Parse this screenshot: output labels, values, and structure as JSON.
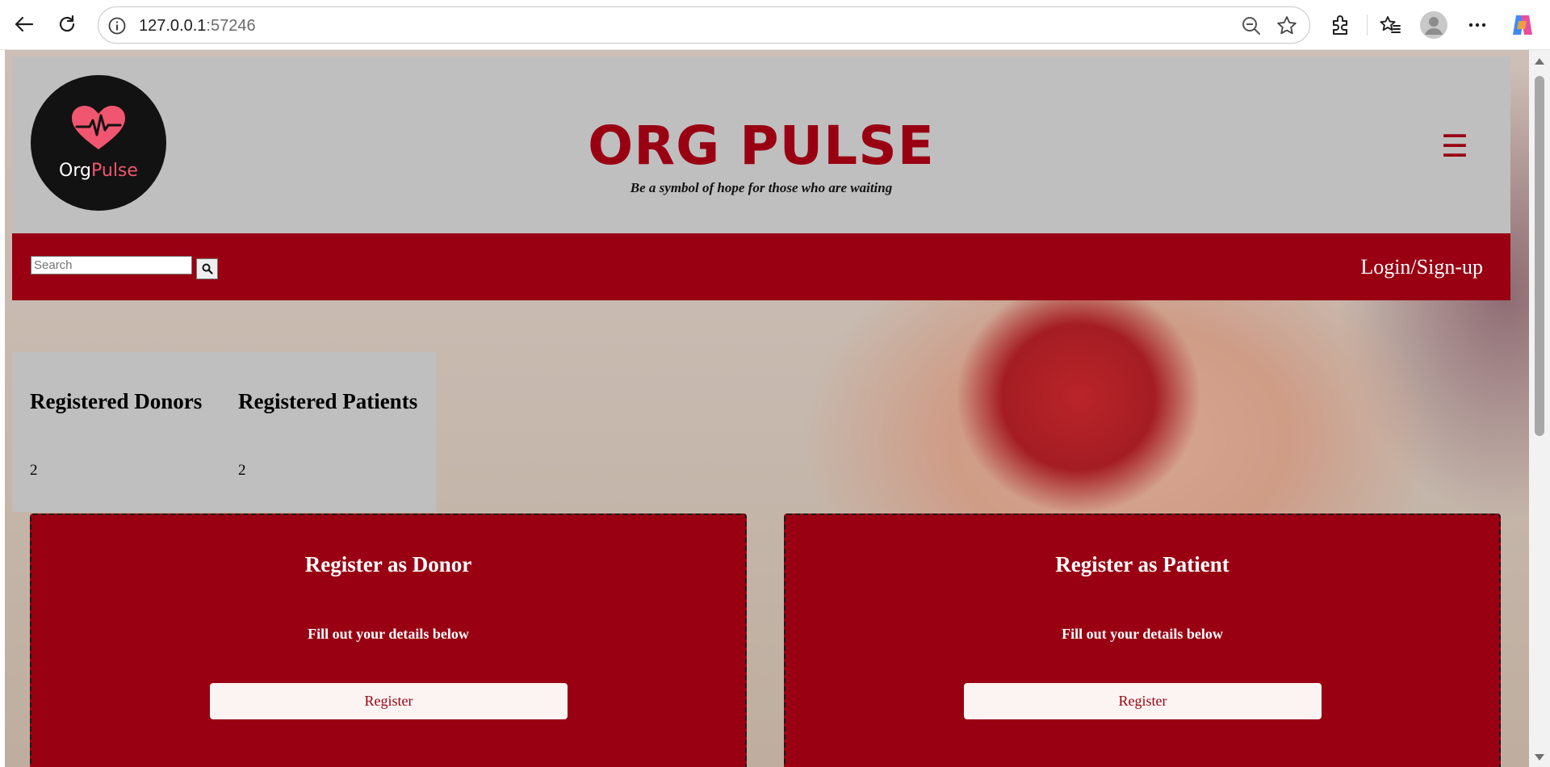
{
  "browser": {
    "url_host": "127.0.0.1",
    "url_port": ":57246",
    "icons": [
      "back-arrow-icon",
      "reload-icon",
      "site-info-icon",
      "zoom-out-icon",
      "favorite-star-icon",
      "extensions-icon",
      "favorites-icon",
      "profile-icon",
      "more-icon",
      "copilot-icon"
    ]
  },
  "header": {
    "logo_text_part1": "Org",
    "logo_text_part2": "Pulse",
    "title": "ORG PULSE",
    "tagline": "Be a symbol of hope for those who are waiting",
    "menu_icon": "☰"
  },
  "nav": {
    "search_placeholder": "Search",
    "login_label": "Login/Sign-up"
  },
  "stats": {
    "donors_label": "Registered Donors",
    "donors_count": "2",
    "patients_label": "Registered Patients",
    "patients_count": "2"
  },
  "cards": {
    "donor": {
      "title": "Register as Donor",
      "subtitle": "Fill out your details below",
      "button": "Register"
    },
    "patient": {
      "title": "Register as Patient",
      "subtitle": "Fill out your details below",
      "button": "Register"
    }
  },
  "colors": {
    "brand_red": "#990012",
    "header_gray": "#bfbfbf",
    "logo_heart": "#f0566f",
    "button_bg": "#fbf4f2"
  }
}
